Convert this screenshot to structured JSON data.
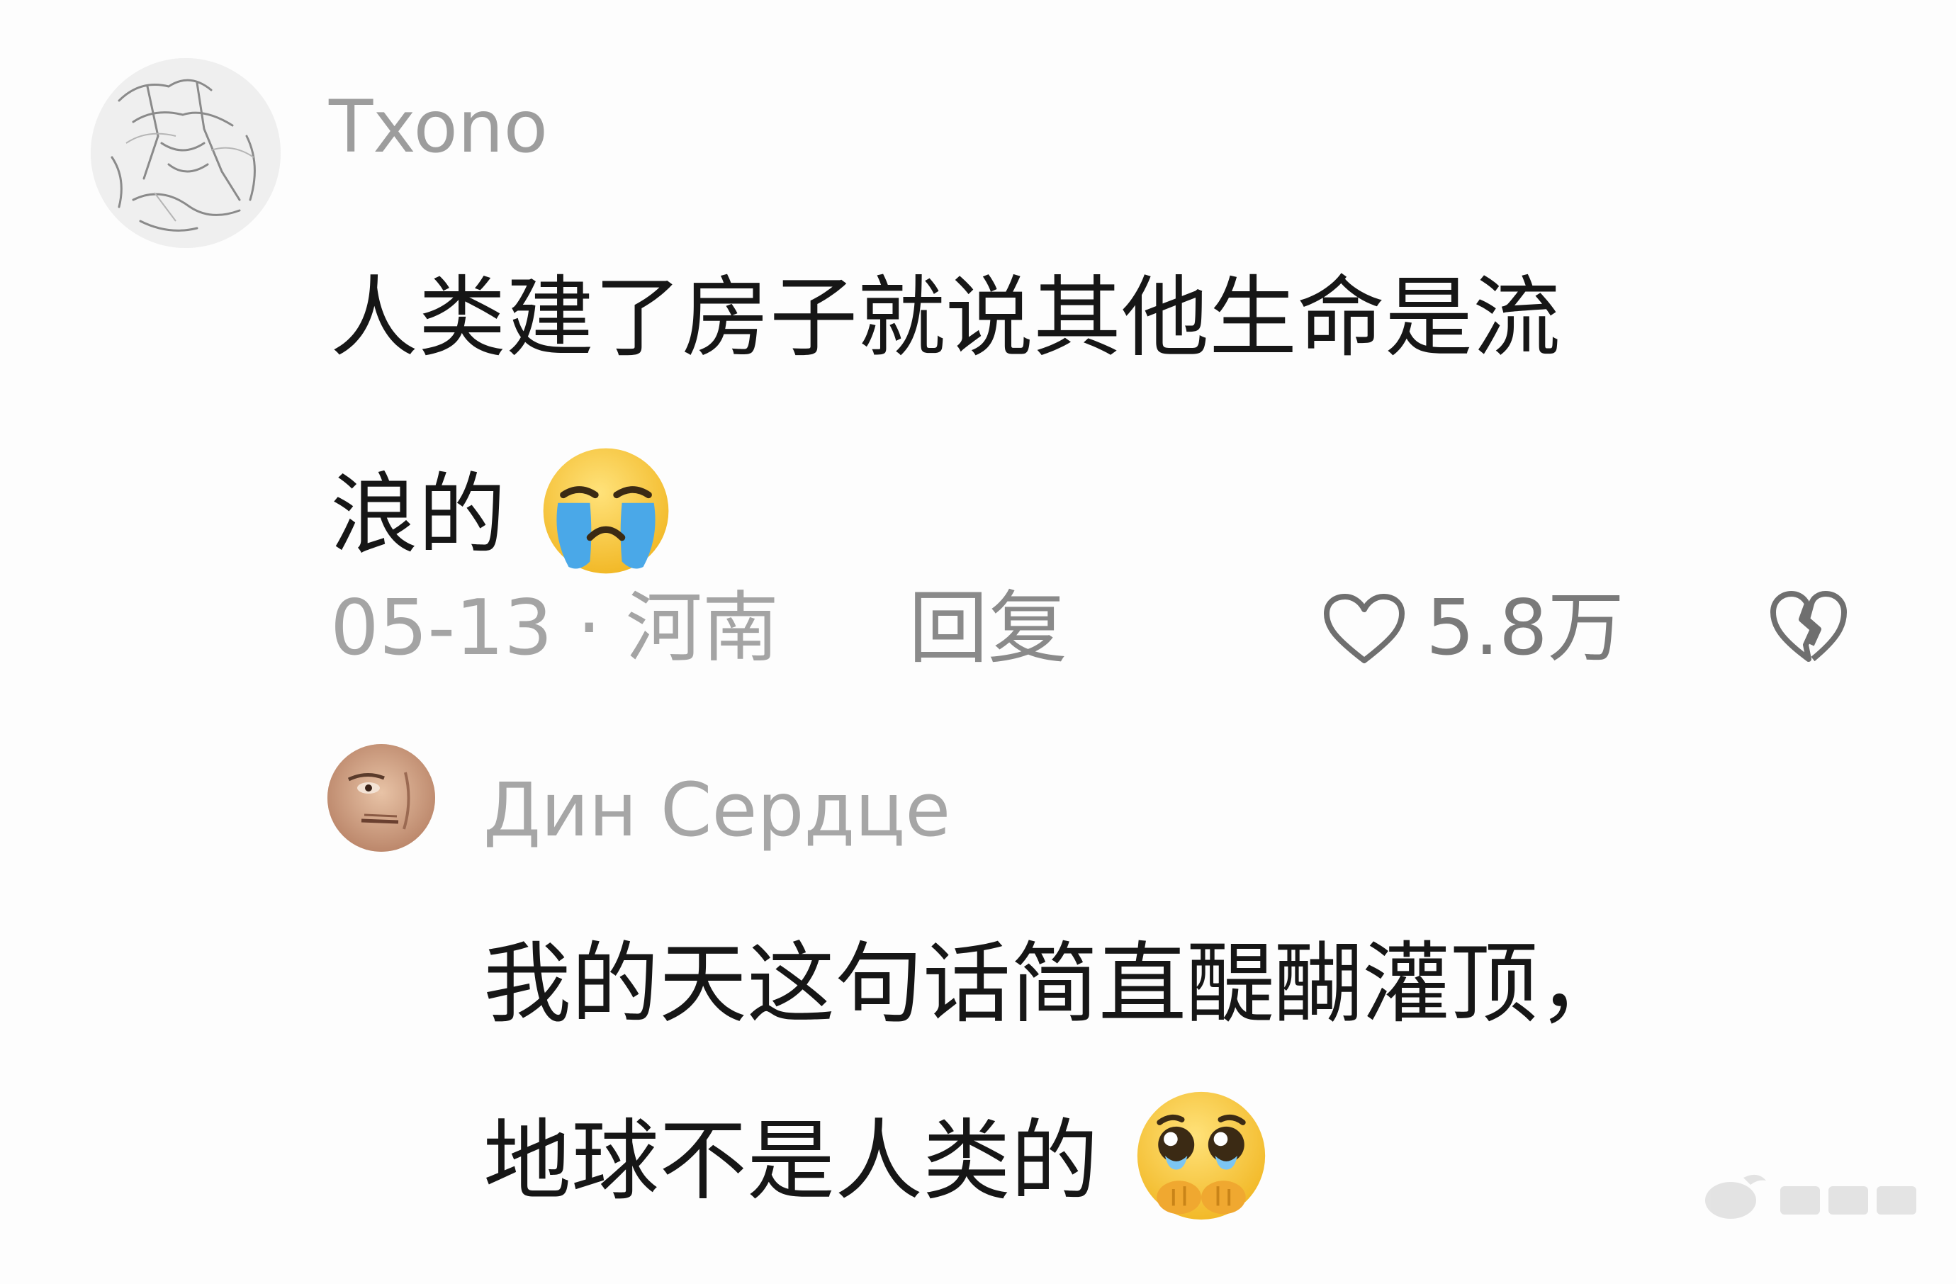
{
  "main_comment": {
    "username": "Txono",
    "text_line1": "人类建了房子就说其他生命是流",
    "text_line2": "浪的",
    "emoji_icon": "loudly-crying-face-icon",
    "date": "05-13",
    "separator": "·",
    "location": "河南",
    "reply_label": "回复",
    "like_icon": "heart-outline-icon",
    "like_count": "5.8万",
    "dislike_icon": "broken-heart-icon"
  },
  "reply_comment": {
    "username": "Дин Сердце",
    "text_line1": "我的天这句话简直醍醐灌顶，",
    "text_line2": "地球不是人类的",
    "emoji_icon": "pleading-face-icon"
  },
  "colors": {
    "background": "#fdfdfd",
    "text_primary": "#161616",
    "text_secondary": "#a4a4a4",
    "emoji_yellow": "#f7c948",
    "tear_blue": "#4aa8e8"
  }
}
